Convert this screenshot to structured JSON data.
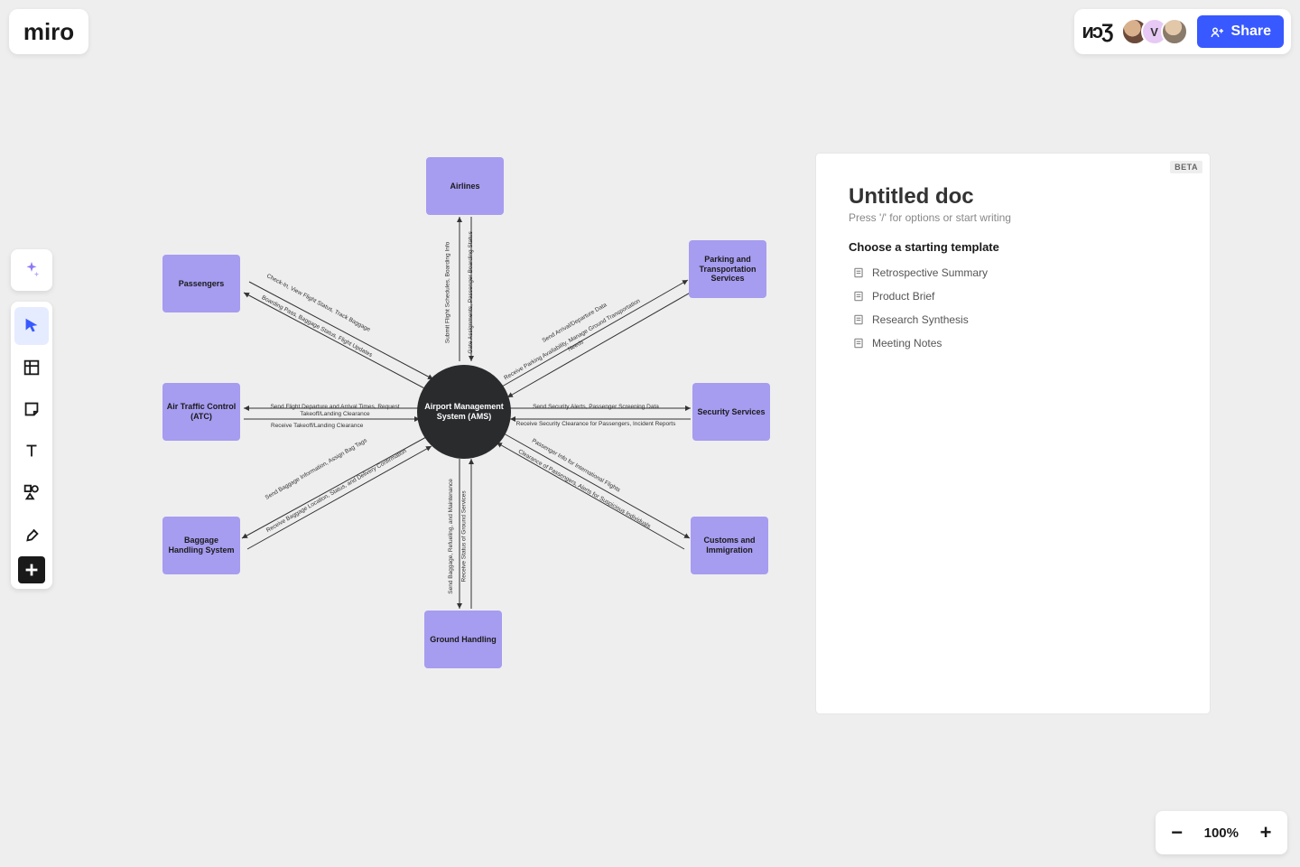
{
  "brand": "miro",
  "header": {
    "collab_glyph": "ᴎᴐƷ",
    "avatars": [
      {
        "bg": "radial-gradient(circle at 40% 35%, #d9b08c 0 40%, #6b4a3a 41% 100%)",
        "initial": ""
      },
      {
        "bg": "#e7c9f5",
        "initial": "V"
      },
      {
        "bg": "radial-gradient(circle at 45% 30%, #e2c7a9 0 40%, #8a7a6a 41% 100%)",
        "initial": ""
      }
    ],
    "share_label": "Share"
  },
  "toolbar_names": [
    "select-tool",
    "frame-tool",
    "sticky-tool",
    "text-tool",
    "shapes-tool",
    "pen-tool",
    "add-tool"
  ],
  "zoom": {
    "level": "100%"
  },
  "doc": {
    "beta": "BETA",
    "title": "Untitled doc",
    "hint": "Press '/' for options or start writing",
    "templates_heading": "Choose a starting template",
    "templates": [
      "Retrospective Summary",
      "Product Brief",
      "Research Synthesis",
      "Meeting Notes"
    ]
  },
  "diagram": {
    "center": "Airport Management System (AMS)",
    "nodes": {
      "airlines": "Airlines",
      "parking": "Parking and Transportation Services",
      "security": "Security Services",
      "customs": "Customs and Immigration",
      "ground": "Ground Handling",
      "baggage": "Baggage Handling System",
      "atc": "Air Traffic Control (ATC)",
      "passengers": "Passengers"
    },
    "edges": {
      "airlines_out": "Submit Flight Schedules, Boarding Info",
      "airlines_in": "Gate Assignments, Passenger Boarding Status",
      "parking_out": "Send Arrival/Departure Data",
      "parking_in": "Receive Parking Availability, Manage Ground Transportation Needs",
      "security_out": "Send Security Alerts, Passenger Screening Data",
      "security_in": "Receive Security Clearance for Passengers, Incident Reports",
      "customs_out": "Passenger Info for International Flights",
      "customs_in": "Clearance of Passengers, Alerts for Suspicious Individuals",
      "ground_out": "Send Baggage, Refueling, and Maintenance",
      "ground_in": "Receive Status of Ground Services",
      "baggage_out": "Send Baggage Information, Assign Bag Tags",
      "baggage_in": "Receive Baggage Location, Status, and Delivery Confirmation",
      "atc_out": "Send Flight Departure and Arrival Times, Request Takeoff/Landing Clearance",
      "atc_in": "Receive Takeoff/Landing Clearance",
      "passengers_out": "Check-In, View Flight Status, Track Baggage",
      "passengers_in": "Boarding Pass, Baggage Status, Flight Updates"
    }
  }
}
